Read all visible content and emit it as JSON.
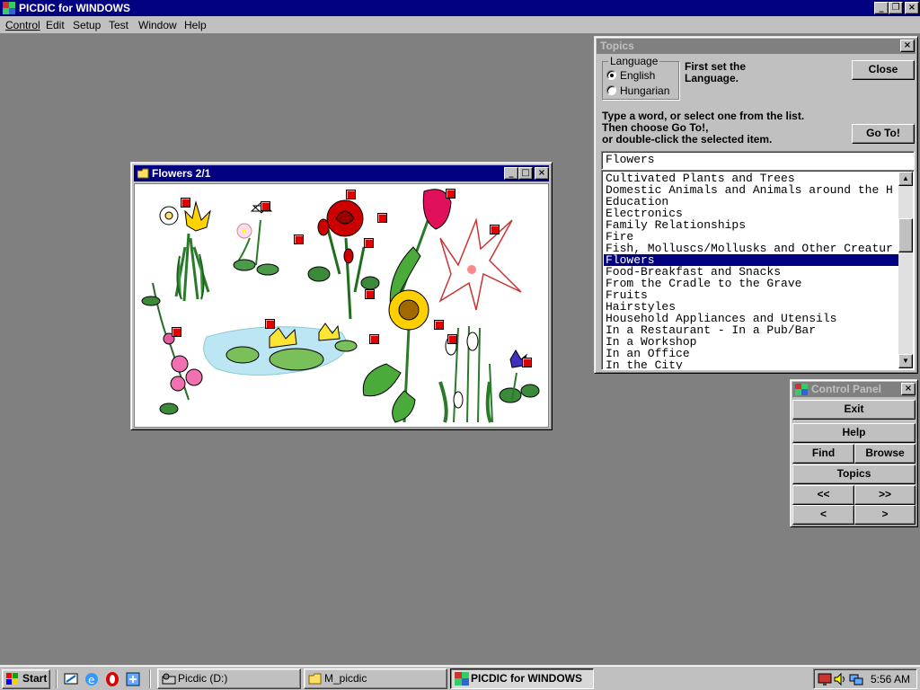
{
  "app": {
    "title": "PICDIC for WINDOWS"
  },
  "menu": [
    "Control",
    "Edit",
    "Setup",
    "Test",
    "Window",
    "Help"
  ],
  "flowers_window": {
    "title": "Flowers 2/1"
  },
  "topics": {
    "title": "Topics",
    "language_label": "Language",
    "languages": [
      {
        "label": "English",
        "selected": true
      },
      {
        "label": "Hungarian",
        "selected": false
      }
    ],
    "hint1": "First set the\nLanguage.",
    "close_label": "Close",
    "hint2": "Type a word, or select one from the list.\nThen choose Go To!,\nor double-click the selected item.",
    "goto_label": "Go To!",
    "input_value": "Flowers",
    "items": [
      "Cultivated Plants and Trees",
      "Domestic Animals and Animals around the H",
      "Education",
      "Electronics",
      "Family Relationships",
      "Fire",
      "Fish, Molluscs/Mollusks and Other Creatur",
      "Flowers",
      "Food-Breakfast and Snacks",
      "From the Cradle to the Grave",
      "Fruits",
      "Hairstyles",
      "Household Appliances and Utensils",
      "In a Restaurant - In a Pub/Bar",
      "In a Workshop",
      "In an Office",
      "In the City"
    ],
    "selected_item": "Flowers"
  },
  "control_panel": {
    "title": "Control Panel",
    "exit": "Exit",
    "help": "Help",
    "find": "Find",
    "browse": "Browse",
    "topics": "Topics",
    "first": "<<",
    "last": ">>",
    "prev": "<",
    "next": ">"
  },
  "taskbar": {
    "start": "Start",
    "tasks": [
      {
        "label": "Picdic (D:)",
        "active": false
      },
      {
        "label": "M_picdic",
        "active": false
      },
      {
        "label": "PICDIC for WINDOWS",
        "active": true
      }
    ],
    "clock": "5:56 AM"
  },
  "colors": {
    "titlebar_active": "#000080",
    "titlebar_inactive": "#808080",
    "face": "#c0c0c0",
    "desktop": "#808080",
    "hotspot": "#e00000"
  }
}
